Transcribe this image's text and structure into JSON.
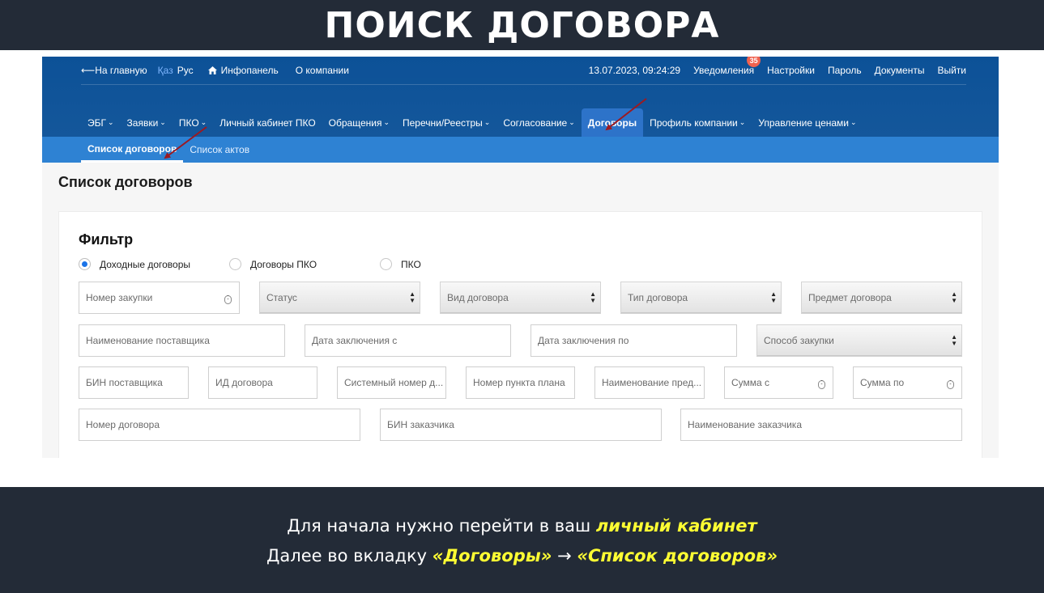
{
  "slide": {
    "title": "ПОИСК ДОГОВОРА",
    "line1_prefix": "Для начала нужно перейти в ваш",
    "line1_highlight": "личный кабинет",
    "line2_prefix": "Далее во вкладку",
    "line2_highlight1": "«Договоры»",
    "line2_arrow": "→",
    "line2_highlight2": "«Список договоров»",
    "highlight_color": "#ffff33",
    "band_color": "#232b37"
  },
  "topbar": {
    "home": "⟵На главную",
    "lang_kaz": "Қаз",
    "lang_rus": "Рус",
    "infopanel": "Инфопанель",
    "about": "О компании",
    "datetime": "13.07.2023, 09:24:29",
    "notifications": "Уведомления",
    "notifications_count": "35",
    "settings": "Настройки",
    "password": "Пароль",
    "documents": "Документы",
    "logout": "Выйти"
  },
  "nav": {
    "items": [
      {
        "label": "ЭБГ",
        "caret": "⌄"
      },
      {
        "label": "Заявки",
        "caret": "⌄"
      },
      {
        "label": "ПКО",
        "caret": "⌄"
      },
      {
        "label": "Личный кабинет ПКО",
        "caret": ""
      },
      {
        "label": "Обращения",
        "caret": "⌄"
      },
      {
        "label": "Перечни/Реестры",
        "caret": "⌄"
      },
      {
        "label": "Согласование",
        "caret": "⌄"
      },
      {
        "label": "Договоры",
        "caret": ""
      },
      {
        "label": "Профиль компании",
        "caret": "⌄"
      },
      {
        "label": "Управление ценами",
        "caret": "⌄"
      }
    ],
    "active": "Договоры",
    "accent": "#0c5197"
  },
  "subnav": {
    "items": [
      "Список договоров",
      "Список актов"
    ],
    "active": "Список договоров"
  },
  "page": {
    "title": "Список договоров"
  },
  "filter": {
    "title": "Фильтр",
    "radios": [
      "Доходные договоры",
      "Договоры ПКО",
      "ПКО"
    ],
    "radio_selected": "Доходные договоры",
    "row1": [
      "Номер закупки",
      "Статус",
      "Вид договора",
      "Тип договора",
      "Предмет договора"
    ],
    "row2": [
      "Наименование поставщика",
      "Дата заключения с",
      "Дата заключения по",
      "Способ закупки"
    ],
    "row3": [
      "БИН поставщика",
      "ИД договора",
      "Системный номер д...",
      "Номер пункта плана",
      "Наименование пред...",
      "Сумма с",
      "Сумма по"
    ],
    "row4": [
      "Номер договора",
      "БИН заказчика",
      "Наименование заказчика"
    ]
  }
}
